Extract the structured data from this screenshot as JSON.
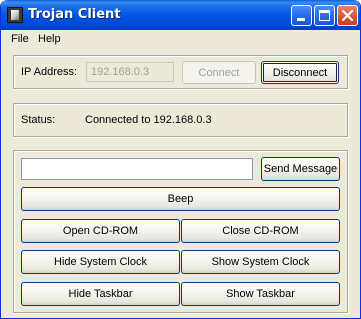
{
  "window": {
    "title": "Trojan Client"
  },
  "menu": {
    "items": [
      "File",
      "Help"
    ]
  },
  "connection": {
    "ip_label": "IP Address:",
    "ip_value": "192.168.0.3",
    "connect_label": "Connect",
    "disconnect_label": "Disconnect"
  },
  "status": {
    "label": "Status:",
    "value": "Connected to 192.168.0.3"
  },
  "commands": {
    "message_value": "",
    "send_message_label": "Send Message",
    "beep_label": "Beep",
    "open_cdrom_label": "Open CD-ROM",
    "close_cdrom_label": "Close CD-ROM",
    "hide_clock_label": "Hide System Clock",
    "show_clock_label": "Show System Clock",
    "hide_taskbar_label": "Hide Taskbar",
    "show_taskbar_label": "Show Taskbar"
  },
  "colors": {
    "titlebar": "#0055e5",
    "window_bg": "#ece9d8",
    "close_button": "#d95b3d"
  },
  "icons": {
    "app": "trojan-app-icon",
    "minimize": "minimize-icon",
    "maximize": "maximize-icon",
    "close": "close-icon"
  }
}
